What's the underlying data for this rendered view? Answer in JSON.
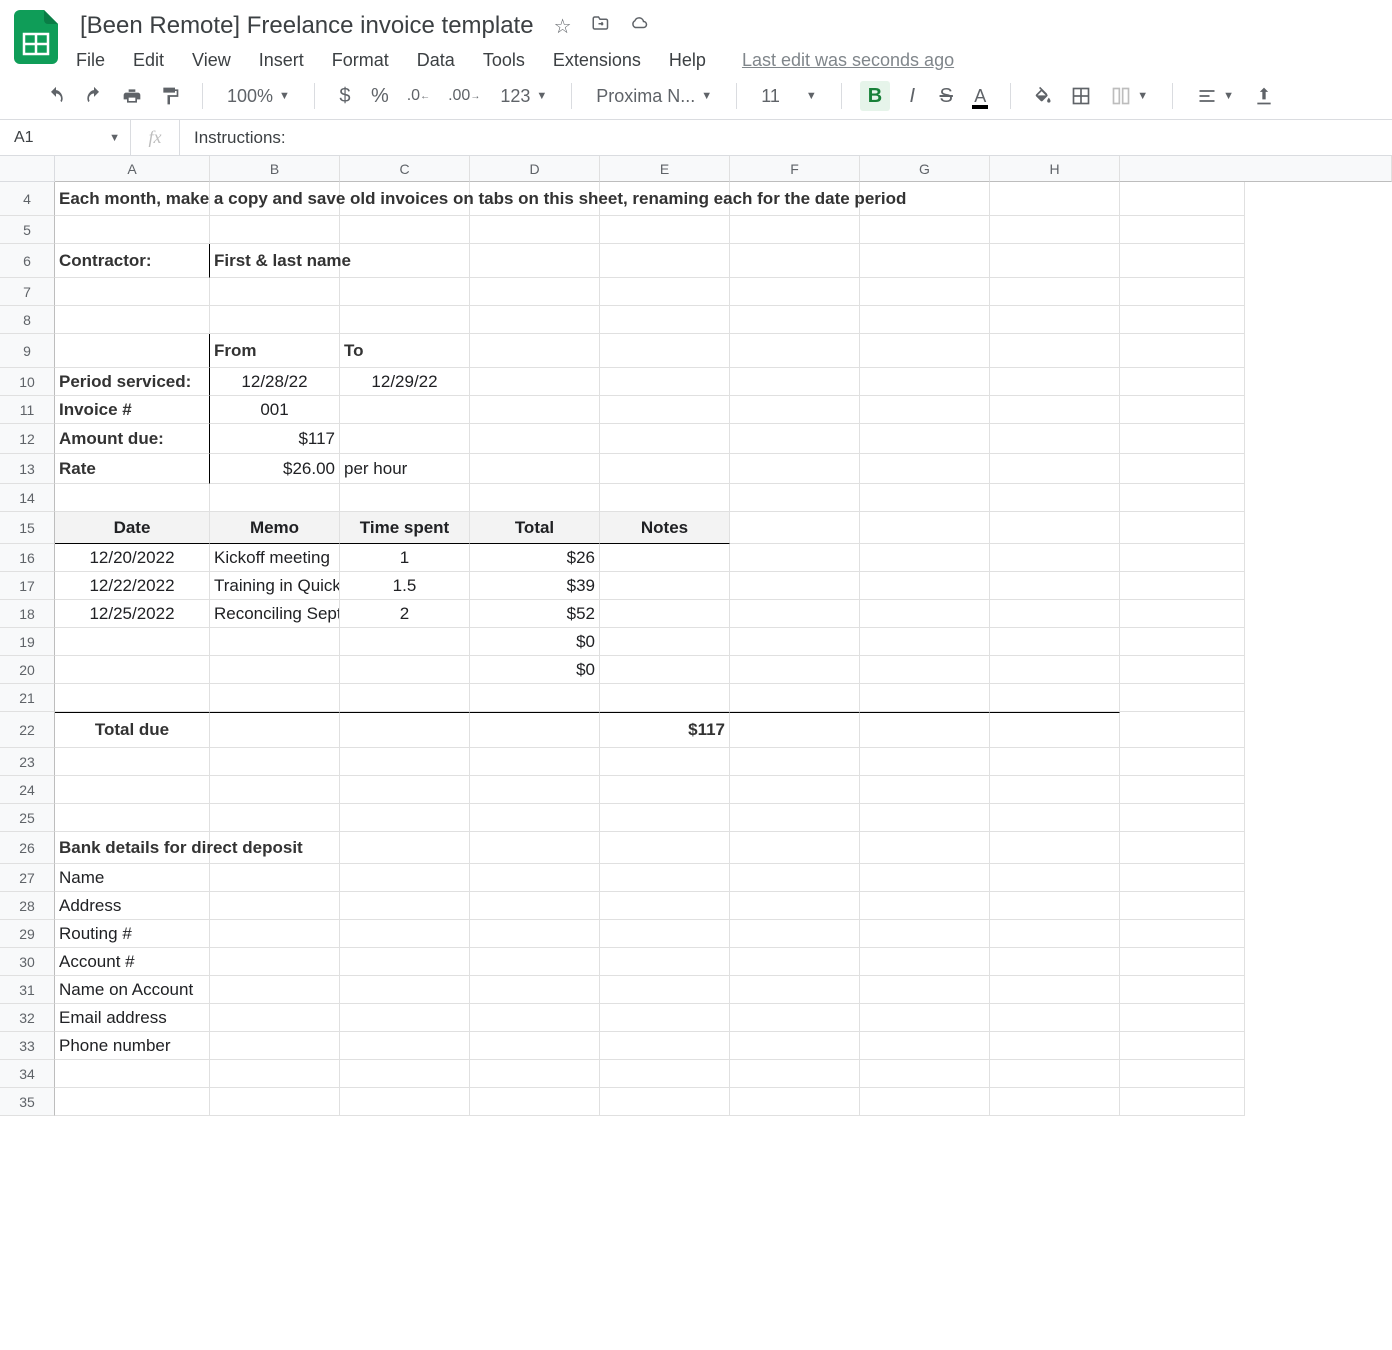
{
  "doc": {
    "title": "[Been Remote] Freelance invoice template",
    "menus": [
      "File",
      "Edit",
      "View",
      "Insert",
      "Format",
      "Data",
      "Tools",
      "Extensions",
      "Help"
    ],
    "last_edit": "Last edit was seconds ago"
  },
  "toolbar": {
    "zoom": "100%",
    "more_formats": "123",
    "font": "Proxima N...",
    "font_size": "11"
  },
  "fx": {
    "name_box": "A1",
    "formula": "Instructions:"
  },
  "grid": {
    "columns": [
      "A",
      "B",
      "C",
      "D",
      "E",
      "F",
      "G",
      "H"
    ],
    "row_start": 4,
    "row_count": 32,
    "row_heights": {
      "4": 34,
      "6": 34,
      "9": 34,
      "12": 30,
      "13": 30,
      "15": 32,
      "22": 36,
      "26": 32
    },
    "default_row_height": 28
  },
  "sheet": {
    "row4": {
      "text": "Each month, make a copy and save old invoices on tabs on this sheet, renaming each for the date period"
    },
    "row6": {
      "a": "Contractor:",
      "b": "First & last name"
    },
    "row9": {
      "b": "From",
      "c": "To"
    },
    "row10": {
      "a": "Period serviced:",
      "b": "12/28/22",
      "c": "12/29/22"
    },
    "row11": {
      "a": "Invoice #",
      "b": "001"
    },
    "row12": {
      "a": "Amount due:",
      "b": "$117"
    },
    "row13": {
      "a": "Rate",
      "b": "$26.00",
      "c": "per hour"
    },
    "row15": {
      "a": "Date",
      "b": "Memo",
      "c": "Time spent",
      "d": "Total",
      "e": "Notes"
    },
    "row16": {
      "a": "12/20/2022",
      "b": "Kickoff meeting",
      "c": "1",
      "d": "$26"
    },
    "row17": {
      "a": "12/22/2022",
      "b": "Training in Quickbooks",
      "c": "1.5",
      "d": "$39"
    },
    "row18": {
      "a": "12/25/2022",
      "b": "Reconciling September",
      "c": "2",
      "d": "$52"
    },
    "row19": {
      "d": "$0"
    },
    "row20": {
      "d": "$0"
    },
    "row22": {
      "a": "Total due",
      "e": "$117"
    },
    "row26": {
      "a": "Bank details for direct deposit"
    },
    "row27": {
      "a": "Name"
    },
    "row28": {
      "a": "Address"
    },
    "row29": {
      "a": "Routing #"
    },
    "row30": {
      "a": "Account #"
    },
    "row31": {
      "a": "Name on Account"
    },
    "row32": {
      "a": "Email address"
    },
    "row33": {
      "a": "Phone number"
    }
  }
}
